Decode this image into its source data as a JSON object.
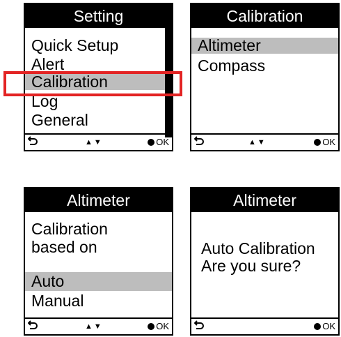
{
  "screens": {
    "setting": {
      "title": "Setting",
      "items": [
        {
          "label": "Quick Setup"
        },
        {
          "label": "Alert"
        },
        {
          "label": "Calibration"
        },
        {
          "label": "Log"
        },
        {
          "label": "General"
        }
      ],
      "footer": {
        "back_icon": "back-arrow-icon",
        "nav": "▲▼",
        "ok": "OK"
      }
    },
    "calibration": {
      "title": "Calibration",
      "items": [
        {
          "label": "Altimeter"
        },
        {
          "label": "Compass"
        }
      ],
      "footer": {
        "back_icon": "back-arrow-icon",
        "nav": "▲▼",
        "ok": "OK"
      }
    },
    "altimeter_mode": {
      "title": "Altimeter",
      "prompt_line1": "Calibration",
      "prompt_line2": "based on",
      "options": [
        {
          "label": "Auto"
        },
        {
          "label": "Manual"
        }
      ],
      "footer": {
        "back_icon": "back-arrow-icon",
        "nav": "▲▼",
        "ok": "OK"
      }
    },
    "altimeter_confirm": {
      "title": "Altimeter",
      "message_line1": "Auto Calibration",
      "message_line2": "Are you sure?",
      "footer": {
        "back_icon": "back-arrow-icon",
        "ok": "OK"
      }
    }
  },
  "highlight": {
    "target": "Calibration",
    "color": "#e32424"
  },
  "colors": {
    "title_bg": "#000000",
    "selected_bg": "#bdbdbd"
  }
}
